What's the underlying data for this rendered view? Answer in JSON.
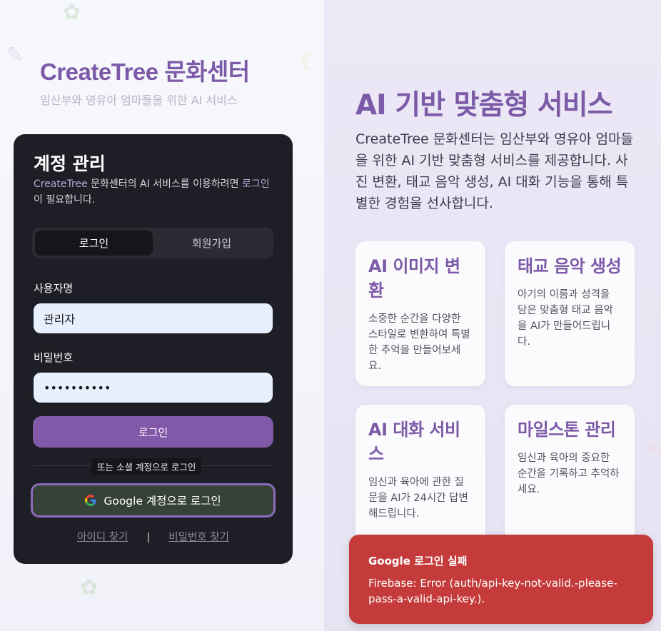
{
  "header": {
    "brand": "CreateTree 문화센터",
    "tagline": "임산부와 영유아 엄마들을 위한 AI 서비스"
  },
  "account_card": {
    "title": "계정 관리",
    "description_prefix": "CreateTree",
    "description_mid": " 문화센터의 AI 서비스를 이용하려면 ",
    "description_link": "로그인",
    "description_suffix": "이 필요합니다.",
    "tabs": [
      {
        "label": "로그인",
        "active": true
      },
      {
        "label": "회원가입",
        "active": false
      }
    ],
    "username_label": "사용자명",
    "username_value": "관리자",
    "password_label": "비밀번호",
    "password_value": "••••••••••",
    "login_button": "로그인",
    "divider_text": "또는 소셜 계정으로 로그인",
    "google_button": "Google 계정으로 로그인",
    "find_id_link": "아이디 찾기",
    "separator": "|",
    "find_password_link": "비밀번호 찾기"
  },
  "promo": {
    "title": "AI 기반 맞춤형 서비스",
    "description": "CreateTree 문화센터는 임산부와 영유아 엄마들을 위한 AI 기반 맞춤형 서비스를 제공합니다. 사진 변환, 태교 음악 생성, AI 대화 기능을 통해 특별한 경험을 선사합니다.",
    "features": [
      {
        "title": "AI 이미지 변환",
        "text": "소중한 순간을 다양한 스타일로 변환하여 특별한 추억을 만들어보세요."
      },
      {
        "title": "태교 음악 생성",
        "text": "아기의 이름과 성격을 담은 맞춤형 태교 음악을 AI가 만들어드립니다."
      },
      {
        "title": "AI 대화 서비스",
        "text": "임신과 육아에 관한 질문을 AI가 24시간 답변해드립니다."
      },
      {
        "title": "마일스톤 관리",
        "text": "임신과 육아의 중요한 순간을 기록하고 추억하세요."
      }
    ]
  },
  "toast": {
    "title": "Google 로그인 실패",
    "message": "Firebase: Error (auth/api-key-not-valid.-please-pass-a-valid-api-key.)."
  },
  "colors": {
    "brand": "#7c5aa8",
    "card_bg": "#1e1e26",
    "button": "#8258a8",
    "error": "#c53a3a"
  }
}
